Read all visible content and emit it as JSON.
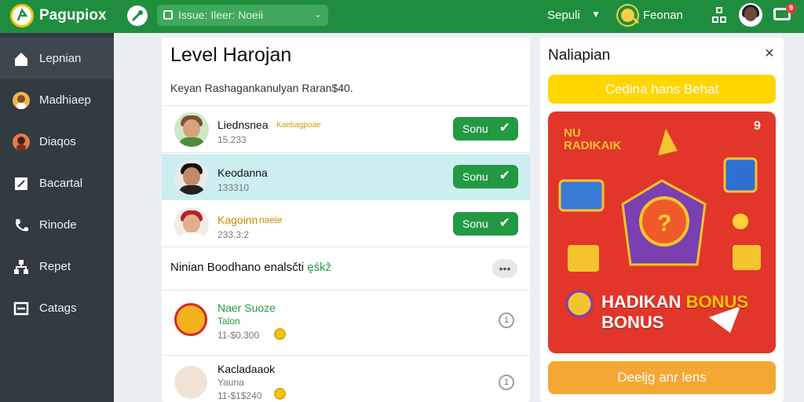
{
  "colors": {
    "brand_green": "#1e8e3e",
    "sidebar": "#323a42",
    "button_green": "#239944",
    "yellow": "#ffd600",
    "orange": "#f5a733",
    "promo_red": "#e2362a"
  },
  "topbar": {
    "logo_text": "Pagupiox",
    "search_placeholder": "Issue: Ileer: Noeii",
    "user_select": "Sepuli",
    "user_name": "Feonan",
    "cart_badge": "9"
  },
  "sidebar": {
    "items": [
      {
        "label": "Lepnian",
        "icon": "home-icon"
      },
      {
        "label": "Madhiaep",
        "icon": "avatar-icon"
      },
      {
        "label": "Diaqos",
        "icon": "person-icon"
      },
      {
        "label": "Bacartal",
        "icon": "edit-icon"
      },
      {
        "label": "Rinode",
        "icon": "phone-icon"
      },
      {
        "label": "Repet",
        "icon": "network-icon"
      },
      {
        "label": "Catags",
        "icon": "list-icon"
      }
    ]
  },
  "main": {
    "title": "Level Harojan",
    "subtitle": "Keyan Rashagankanulyan Raran$40.",
    "users": [
      {
        "name": "Liednsnea",
        "tag": "Kaebagpoae",
        "sub": "15.233",
        "button": "Sonu"
      },
      {
        "name": "Keodanna",
        "tag": "",
        "sub": "133310",
        "button": "Sonu"
      },
      {
        "name": "Kagoinn",
        "tag": "naeie",
        "sub": "233.3:2",
        "button": "Sonu"
      }
    ],
    "section_text": "Ninian Boodhano enalsčti",
    "section_hint": "ęśkž",
    "more_label": "•••",
    "rewards": [
      {
        "title": "Naer Suoze",
        "sub": "Talon",
        "points": "11-$0.300",
        "info": "1"
      },
      {
        "title": "Kacladaaok",
        "sub": "Yauna",
        "points": "11-$1$240",
        "info": "1"
      }
    ]
  },
  "side_panel": {
    "title": "Naliapian",
    "close": "×",
    "top_button": "Cedina hans Behat",
    "promo": {
      "badge_line1": "NU",
      "badge_line2": "RADIKAIK",
      "headline_a": "HADIKAN",
      "headline_b": "BONUS",
      "headline_c": "BONUS",
      "corner": "9"
    },
    "bottom_button": "Deeljg anr lens"
  }
}
